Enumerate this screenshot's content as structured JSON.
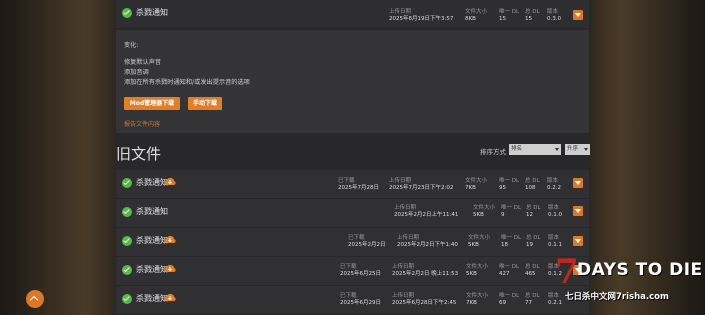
{
  "current": {
    "title": "杀戮通知",
    "upload_label": "上传日期",
    "upload_value": "2025年8月19日下午3:57",
    "size_label": "文件大小",
    "size_value": "8KB",
    "dl_label": "唯一 DL",
    "dl_value": "15",
    "total_label": "总 DL",
    "total_value": "15",
    "version_label": "版本",
    "version_value": "0.3.0"
  },
  "detail": {
    "heading": "变化:",
    "lines": [
      "修复默认声音",
      "添加音调",
      "添加在所有杀戮时通知和/或发出提示音的选项"
    ],
    "mod_manager_btn": "Mod管理器下载",
    "manual_btn": "手动下载",
    "report_link": "报告文件内容"
  },
  "old_files": {
    "title": "旧文件",
    "sort_label": "排序方式",
    "sort_value": "排名",
    "order_value": "升序"
  },
  "rows": [
    {
      "title": "杀戮通知",
      "dl_label": "已下载",
      "dl_date": "2025年7月28日",
      "upload_label": "上传日期",
      "upload": "2025年7月23日下午2:02",
      "size_label": "文件大小",
      "size": "7KB",
      "udl_label": "唯一 DL",
      "udl": "95",
      "tdl_label": "总 DL",
      "tdl": "108",
      "ver_label": "版本",
      "ver": "0.2.2"
    },
    {
      "title": "杀戮通知",
      "upload_label": "上传日期",
      "upload": "2025年2月2日上午11:41",
      "size_label": "文件大小",
      "size": "5KB",
      "udl_label": "唯一 DL",
      "udl": "9",
      "tdl_label": "总 DL",
      "tdl": "12",
      "ver_label": "版本",
      "ver": "0.1.0"
    },
    {
      "title": "杀戮通知",
      "dl_label": "已下载",
      "dl_date": "2025年2月2日",
      "upload_label": "上传日期",
      "upload": "2025年2月2日下午1:40",
      "size_label": "文件大小",
      "size": "5KB",
      "udl_label": "唯一 DL",
      "udl": "18",
      "tdl_label": "总 DL",
      "tdl": "19",
      "ver_label": "版本",
      "ver": "0.1.1"
    },
    {
      "title": "杀戮通知",
      "dl_label": "已下载",
      "dl_date": "2025年6月25日",
      "upload_label": "上传日期",
      "upload": "2025年2月2日 晚上11:53",
      "size_label": "文件大小",
      "size": "5KB",
      "udl_label": "唯一 DL",
      "udl": "427",
      "tdl_label": "总 DL",
      "tdl": "465",
      "ver_label": "版本",
      "ver": "0.1.2"
    },
    {
      "title": "杀戮通知",
      "dl_label": "已下载",
      "dl_date": "2025年6月29日",
      "upload_label": "上传日期",
      "upload": "2025年6月28日下午2:45",
      "size_label": "文件大小",
      "size": "7KB",
      "udl_label": "唯一 DL",
      "udl": "69",
      "tdl_label": "总 DL",
      "tdl": "77",
      "ver_label": "版本",
      "ver": "0.2.1"
    }
  ],
  "watermark": {
    "seven": "7",
    "title": "DAYS TO DIE",
    "subtitle": "七日杀中文网7risha.com"
  },
  "colors": {
    "accent": "#e07f2a",
    "check": "#58b848",
    "version": "#e8912c"
  }
}
